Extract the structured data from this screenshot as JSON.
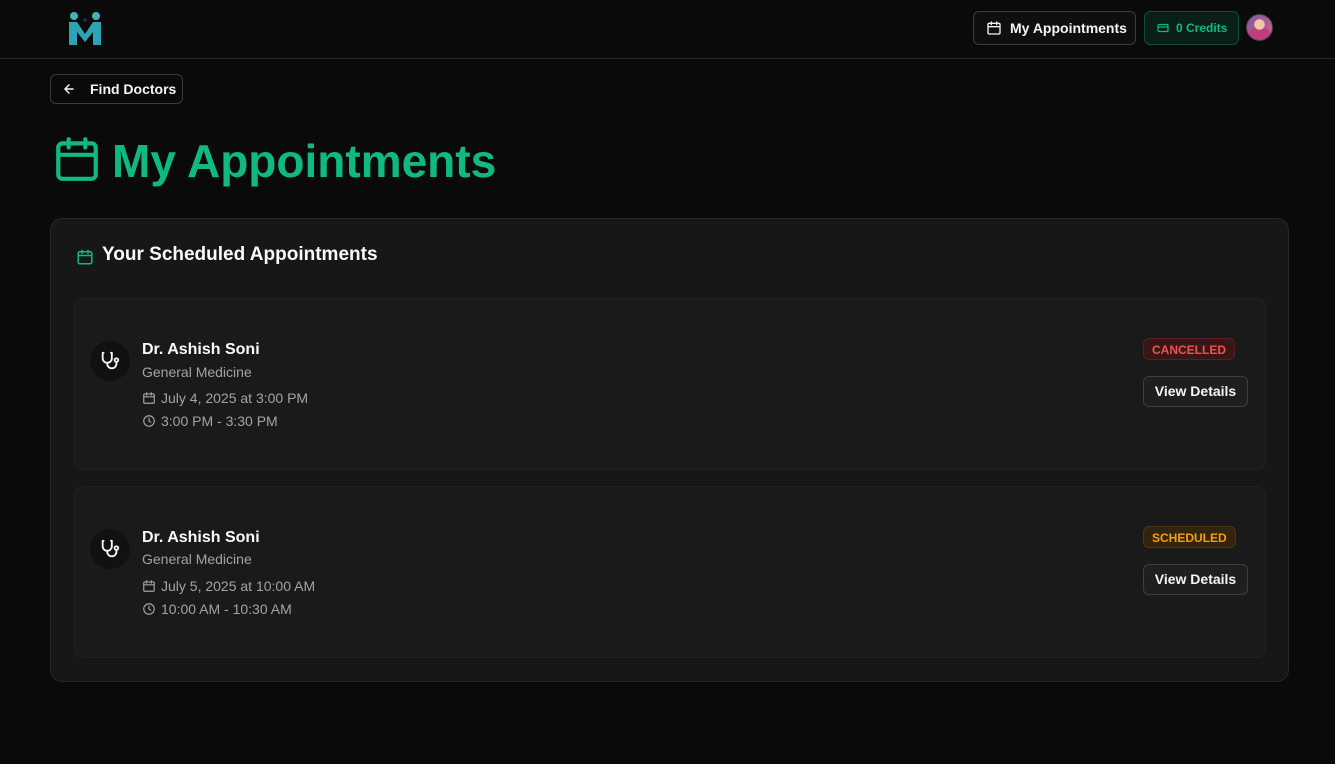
{
  "header": {
    "logo_letter": "M",
    "my_appointments_label": "My Appointments",
    "credits_label": "0 Credits"
  },
  "back_button": {
    "label": "Find Doctors"
  },
  "page": {
    "title": "My Appointments"
  },
  "card": {
    "title": "Your Scheduled Appointments",
    "appointments": [
      {
        "doctor": "Dr. Ashish Soni",
        "specialty": "General Medicine",
        "date": "July 4, 2025 at 3:00 PM",
        "time": "3:00 PM - 3:30 PM",
        "status": "CANCELLED",
        "action": "View Details"
      },
      {
        "doctor": "Dr. Ashish Soni",
        "specialty": "General Medicine",
        "date": "July 5, 2025 at 10:00 AM",
        "time": "10:00 AM - 10:30 AM",
        "status": "SCHEDULED",
        "action": "View Details"
      }
    ]
  },
  "colors": {
    "accent": "#10b981",
    "background": "#0a0a0a",
    "card": "#171717",
    "cancelled": "#f05252",
    "scheduled": "#f59e0b"
  },
  "icons": [
    "app-logo",
    "calendar-icon",
    "credit-card-icon",
    "avatar",
    "arrow-left-icon",
    "stethoscope-icon",
    "clock-icon"
  ]
}
